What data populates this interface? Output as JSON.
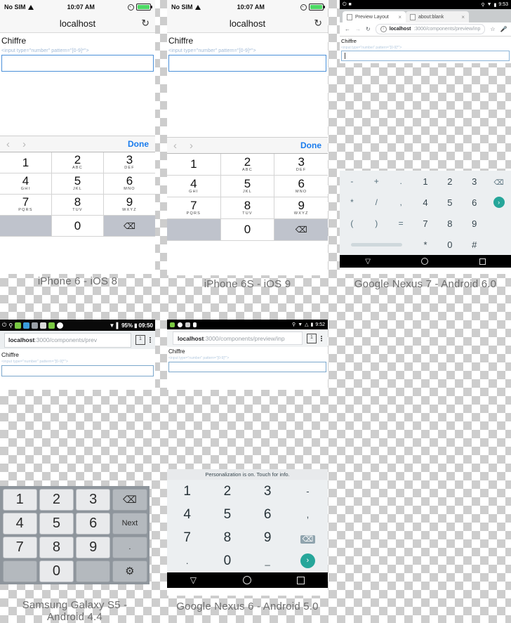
{
  "panels": [
    {
      "id": "iphone6",
      "caption": "iPhone 6 - iOS 8",
      "status": {
        "carrier": "No SIM",
        "time": "10:07 AM"
      },
      "navbar": {
        "title": "localhost",
        "reload_icon": "reload-icon"
      },
      "page": {
        "label": "Chiffre",
        "hint": "<input type=\"number\" pattern=\"[0-9]*\">",
        "input_value": ""
      },
      "accessory": {
        "prev_icon": "chevron-left-icon",
        "next_icon": "chevron-right-icon",
        "done_label": "Done"
      },
      "keyboard": {
        "type": "ios-numberpad",
        "keys": [
          [
            {
              "num": "1",
              "sub": ""
            },
            {
              "num": "2",
              "sub": "ABC"
            },
            {
              "num": "3",
              "sub": "DEF"
            }
          ],
          [
            {
              "num": "4",
              "sub": "GHI"
            },
            {
              "num": "5",
              "sub": "JKL"
            },
            {
              "num": "6",
              "sub": "MNO"
            }
          ],
          [
            {
              "num": "7",
              "sub": "PQRS"
            },
            {
              "num": "8",
              "sub": "TUV"
            },
            {
              "num": "9",
              "sub": "WXYZ"
            }
          ],
          [
            {
              "num": "",
              "sub": ""
            },
            {
              "num": "0",
              "sub": ""
            },
            {
              "num": "⌫",
              "sub": ""
            }
          ]
        ]
      }
    },
    {
      "id": "iphone6s",
      "caption": "iPhone 6S - iOS 9",
      "status": {
        "carrier": "No SIM",
        "time": "10:07 AM"
      },
      "navbar": {
        "title": "localhost",
        "reload_icon": "reload-icon"
      },
      "page": {
        "label": "Chiffre",
        "hint": "<input type=\"number\" pattern=\"[0-9]*\">",
        "input_value": ""
      },
      "accessory": {
        "prev_icon": "chevron-left-icon",
        "next_icon": "chevron-right-icon",
        "done_label": "Done"
      },
      "keyboard": {
        "type": "ios-numberpad",
        "keys": [
          [
            {
              "num": "1",
              "sub": ""
            },
            {
              "num": "2",
              "sub": "ABC"
            },
            {
              "num": "3",
              "sub": "DEF"
            }
          ],
          [
            {
              "num": "4",
              "sub": "GHI"
            },
            {
              "num": "5",
              "sub": "JKL"
            },
            {
              "num": "6",
              "sub": "MNO"
            }
          ],
          [
            {
              "num": "7",
              "sub": "PQRS"
            },
            {
              "num": "8",
              "sub": "TUV"
            },
            {
              "num": "9",
              "sub": "WXYZ"
            }
          ],
          [
            {
              "num": "",
              "sub": ""
            },
            {
              "num": "0",
              "sub": ""
            },
            {
              "num": "⌫",
              "sub": ""
            }
          ]
        ]
      }
    },
    {
      "id": "nexus7",
      "caption": "Google Nexus 7 - Android 6.0",
      "status": {
        "time": "9:53"
      },
      "chrome": {
        "tabs": [
          {
            "title": "Preview Layout",
            "active": true
          },
          {
            "title": "about:blank",
            "active": false
          }
        ],
        "url_host": "localhost",
        "url_path": ":3000/components/preview/inp",
        "back_icon": "arrow-left-icon",
        "forward_icon": "arrow-right-icon",
        "reload_icon": "reload-icon",
        "star_icon": "star-icon",
        "mic_icon": "microphone-icon",
        "menu_icon": "kebab-menu-icon"
      },
      "page": {
        "label": "Chiffre",
        "hint": "<input type=\"number\" pattern=\"[0-9]*\">",
        "input_value": ""
      },
      "keyboard": {
        "type": "android-numeric",
        "rows": [
          [
            "-",
            "+",
            ".",
            "1",
            "2",
            "3",
            "⌫"
          ],
          [
            "*",
            "/",
            ",",
            "4",
            "5",
            "6",
            "go"
          ],
          [
            "(",
            ")",
            "=",
            "7",
            "8",
            "9",
            ""
          ],
          [
            "space",
            "",
            "",
            "*",
            "0",
            "#",
            ""
          ]
        ]
      },
      "navbar": {
        "back_icon": "triangle-back-icon",
        "home_icon": "circle-home-icon",
        "recents_icon": "square-recents-icon"
      }
    },
    {
      "id": "galaxys5",
      "caption_line1": "Samsung Galaxy S5 -",
      "caption_line2": "Android 4.4",
      "status": {
        "battery": "95%",
        "time": "09:50"
      },
      "browser": {
        "url_host": "localhost",
        "url_path": ":3000/components/prev",
        "tab_count": "1",
        "menu_icon": "kebab-menu-icon"
      },
      "page": {
        "label": "Chiffre",
        "hint": "<input type=\"number\" pattern=\"[0-9]*\">",
        "input_value": ""
      },
      "keyboard": {
        "type": "samsung-numeric",
        "rows": [
          [
            {
              "label": "1",
              "style": "light"
            },
            {
              "label": "2",
              "style": "light"
            },
            {
              "label": "3",
              "style": "light"
            },
            {
              "label": "⌫",
              "style": "dark"
            }
          ],
          [
            {
              "label": "4",
              "style": "light"
            },
            {
              "label": "5",
              "style": "light"
            },
            {
              "label": "6",
              "style": "light"
            },
            {
              "label": "Next",
              "style": "dark fn"
            }
          ],
          [
            {
              "label": "7",
              "style": "light"
            },
            {
              "label": "8",
              "style": "light"
            },
            {
              "label": "9",
              "style": "light"
            },
            {
              "label": ".",
              "style": "dark fn"
            }
          ],
          [
            {
              "label": "",
              "style": "dark"
            },
            {
              "label": "0",
              "style": "light"
            },
            {
              "label": "",
              "style": "dark"
            },
            {
              "label": "⚙",
              "style": "dark gear"
            }
          ]
        ]
      }
    },
    {
      "id": "nexus6",
      "caption": "Google Nexus 6 - Android 5.0",
      "status": {
        "time": "9:52"
      },
      "browser": {
        "url_host": "localhost",
        "url_path": ":3000/components/preview/inp",
        "tab_count": "1",
        "menu_icon": "kebab-menu-icon"
      },
      "page": {
        "label": "Chiffre",
        "hint": "<input type=\"number\" pattern=\"[0-9]*\">",
        "input_value": ""
      },
      "keyboard": {
        "type": "android-numeric",
        "notice": "Personalization is on. Touch for info.",
        "rows": [
          [
            "1",
            "2",
            "3",
            "-"
          ],
          [
            "4",
            "5",
            "6",
            ","
          ],
          [
            "7",
            "8",
            "9",
            "⌫"
          ],
          [
            ".",
            "0",
            "_",
            "go"
          ]
        ]
      },
      "navbar": {
        "back_icon": "triangle-back-icon",
        "home_icon": "circle-home-icon",
        "recents_icon": "square-recents-icon"
      }
    }
  ],
  "colors": {
    "ios_accent": "#1a7ced",
    "android_accent": "#26a69a",
    "input_border": "#4a90d9",
    "caption": "#6c6c6c"
  }
}
